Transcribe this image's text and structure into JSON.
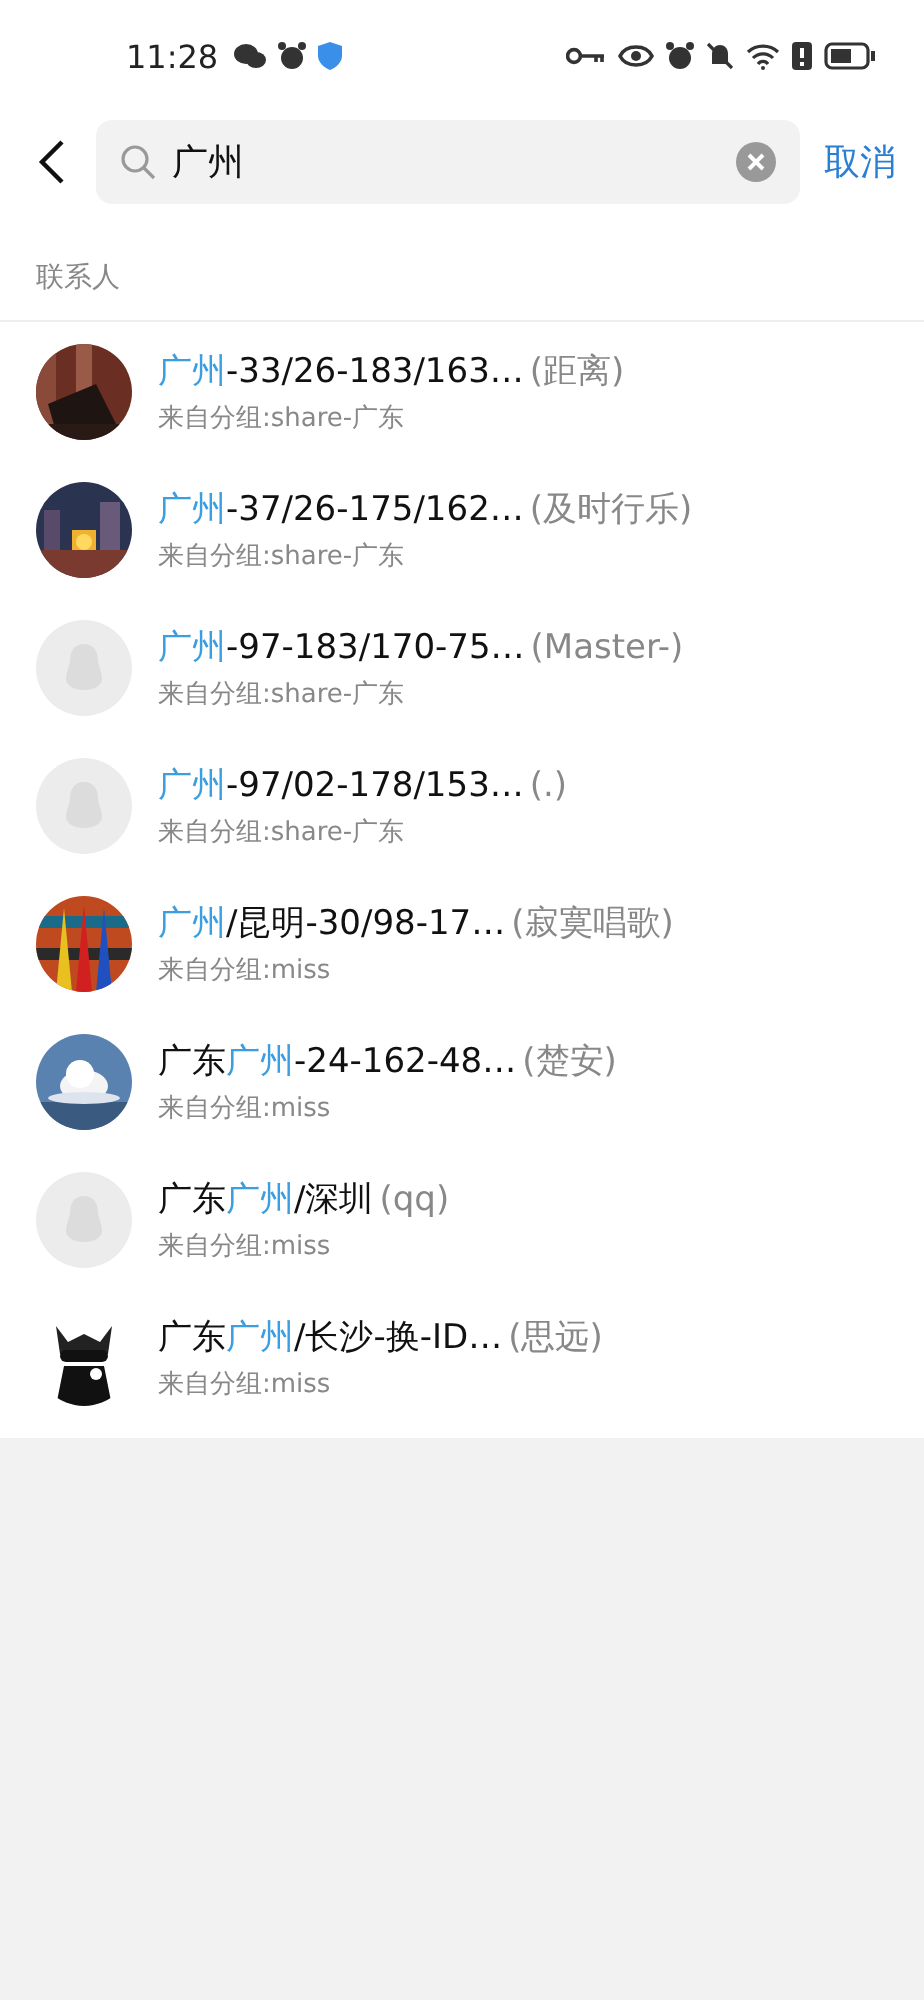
{
  "status_bar": {
    "time": "11:28"
  },
  "search": {
    "query": "广州",
    "cancel": "取消"
  },
  "section": {
    "title": "联系人"
  },
  "contacts": [
    {
      "avatar": {
        "kind": "picture"
      },
      "name": [
        {
          "text": "广州",
          "highlight": true
        },
        {
          "text": "-33/26-183/163…",
          "highlight": false
        }
      ],
      "remark": "(距离)",
      "group": "来自分组:share-广东"
    },
    {
      "avatar": {
        "kind": "picture"
      },
      "name": [
        {
          "text": "广州",
          "highlight": true
        },
        {
          "text": "-37/26-175/162…",
          "highlight": false
        }
      ],
      "remark": "(及时行乐)",
      "group": "来自分组:share-广东"
    },
    {
      "avatar": {
        "kind": "default"
      },
      "name": [
        {
          "text": "广州",
          "highlight": true
        },
        {
          "text": "-97-183/170-75…",
          "highlight": false
        }
      ],
      "remark": "(Master-)",
      "group": "来自分组:share-广东"
    },
    {
      "avatar": {
        "kind": "default"
      },
      "name": [
        {
          "text": "广州",
          "highlight": true
        },
        {
          "text": "-97/02-178/153…",
          "highlight": false
        }
      ],
      "remark": "(.)",
      "group": "来自分组:share-广东"
    },
    {
      "avatar": {
        "kind": "picture"
      },
      "name": [
        {
          "text": "广州",
          "highlight": true
        },
        {
          "text": "/昆明-30/98-17…",
          "highlight": false
        }
      ],
      "remark": "(寂寞唱歌)",
      "group": "来自分组:miss"
    },
    {
      "avatar": {
        "kind": "picture"
      },
      "name": [
        {
          "text": "广东",
          "highlight": false
        },
        {
          "text": "广州",
          "highlight": true
        },
        {
          "text": "-24-162-48…",
          "highlight": false
        }
      ],
      "remark": "(楚安)",
      "group": "来自分组:miss"
    },
    {
      "avatar": {
        "kind": "default"
      },
      "name": [
        {
          "text": "广东",
          "highlight": false
        },
        {
          "text": "广州",
          "highlight": true
        },
        {
          "text": "/深圳",
          "highlight": false
        }
      ],
      "remark": "(qq)",
      "group": "来自分组:miss"
    },
    {
      "avatar": {
        "kind": "picture"
      },
      "name": [
        {
          "text": "广东",
          "highlight": false
        },
        {
          "text": "广州",
          "highlight": true
        },
        {
          "text": "/长沙-换-ID…",
          "highlight": false
        }
      ],
      "remark": "(思远)",
      "group": "来自分组:miss"
    }
  ]
}
